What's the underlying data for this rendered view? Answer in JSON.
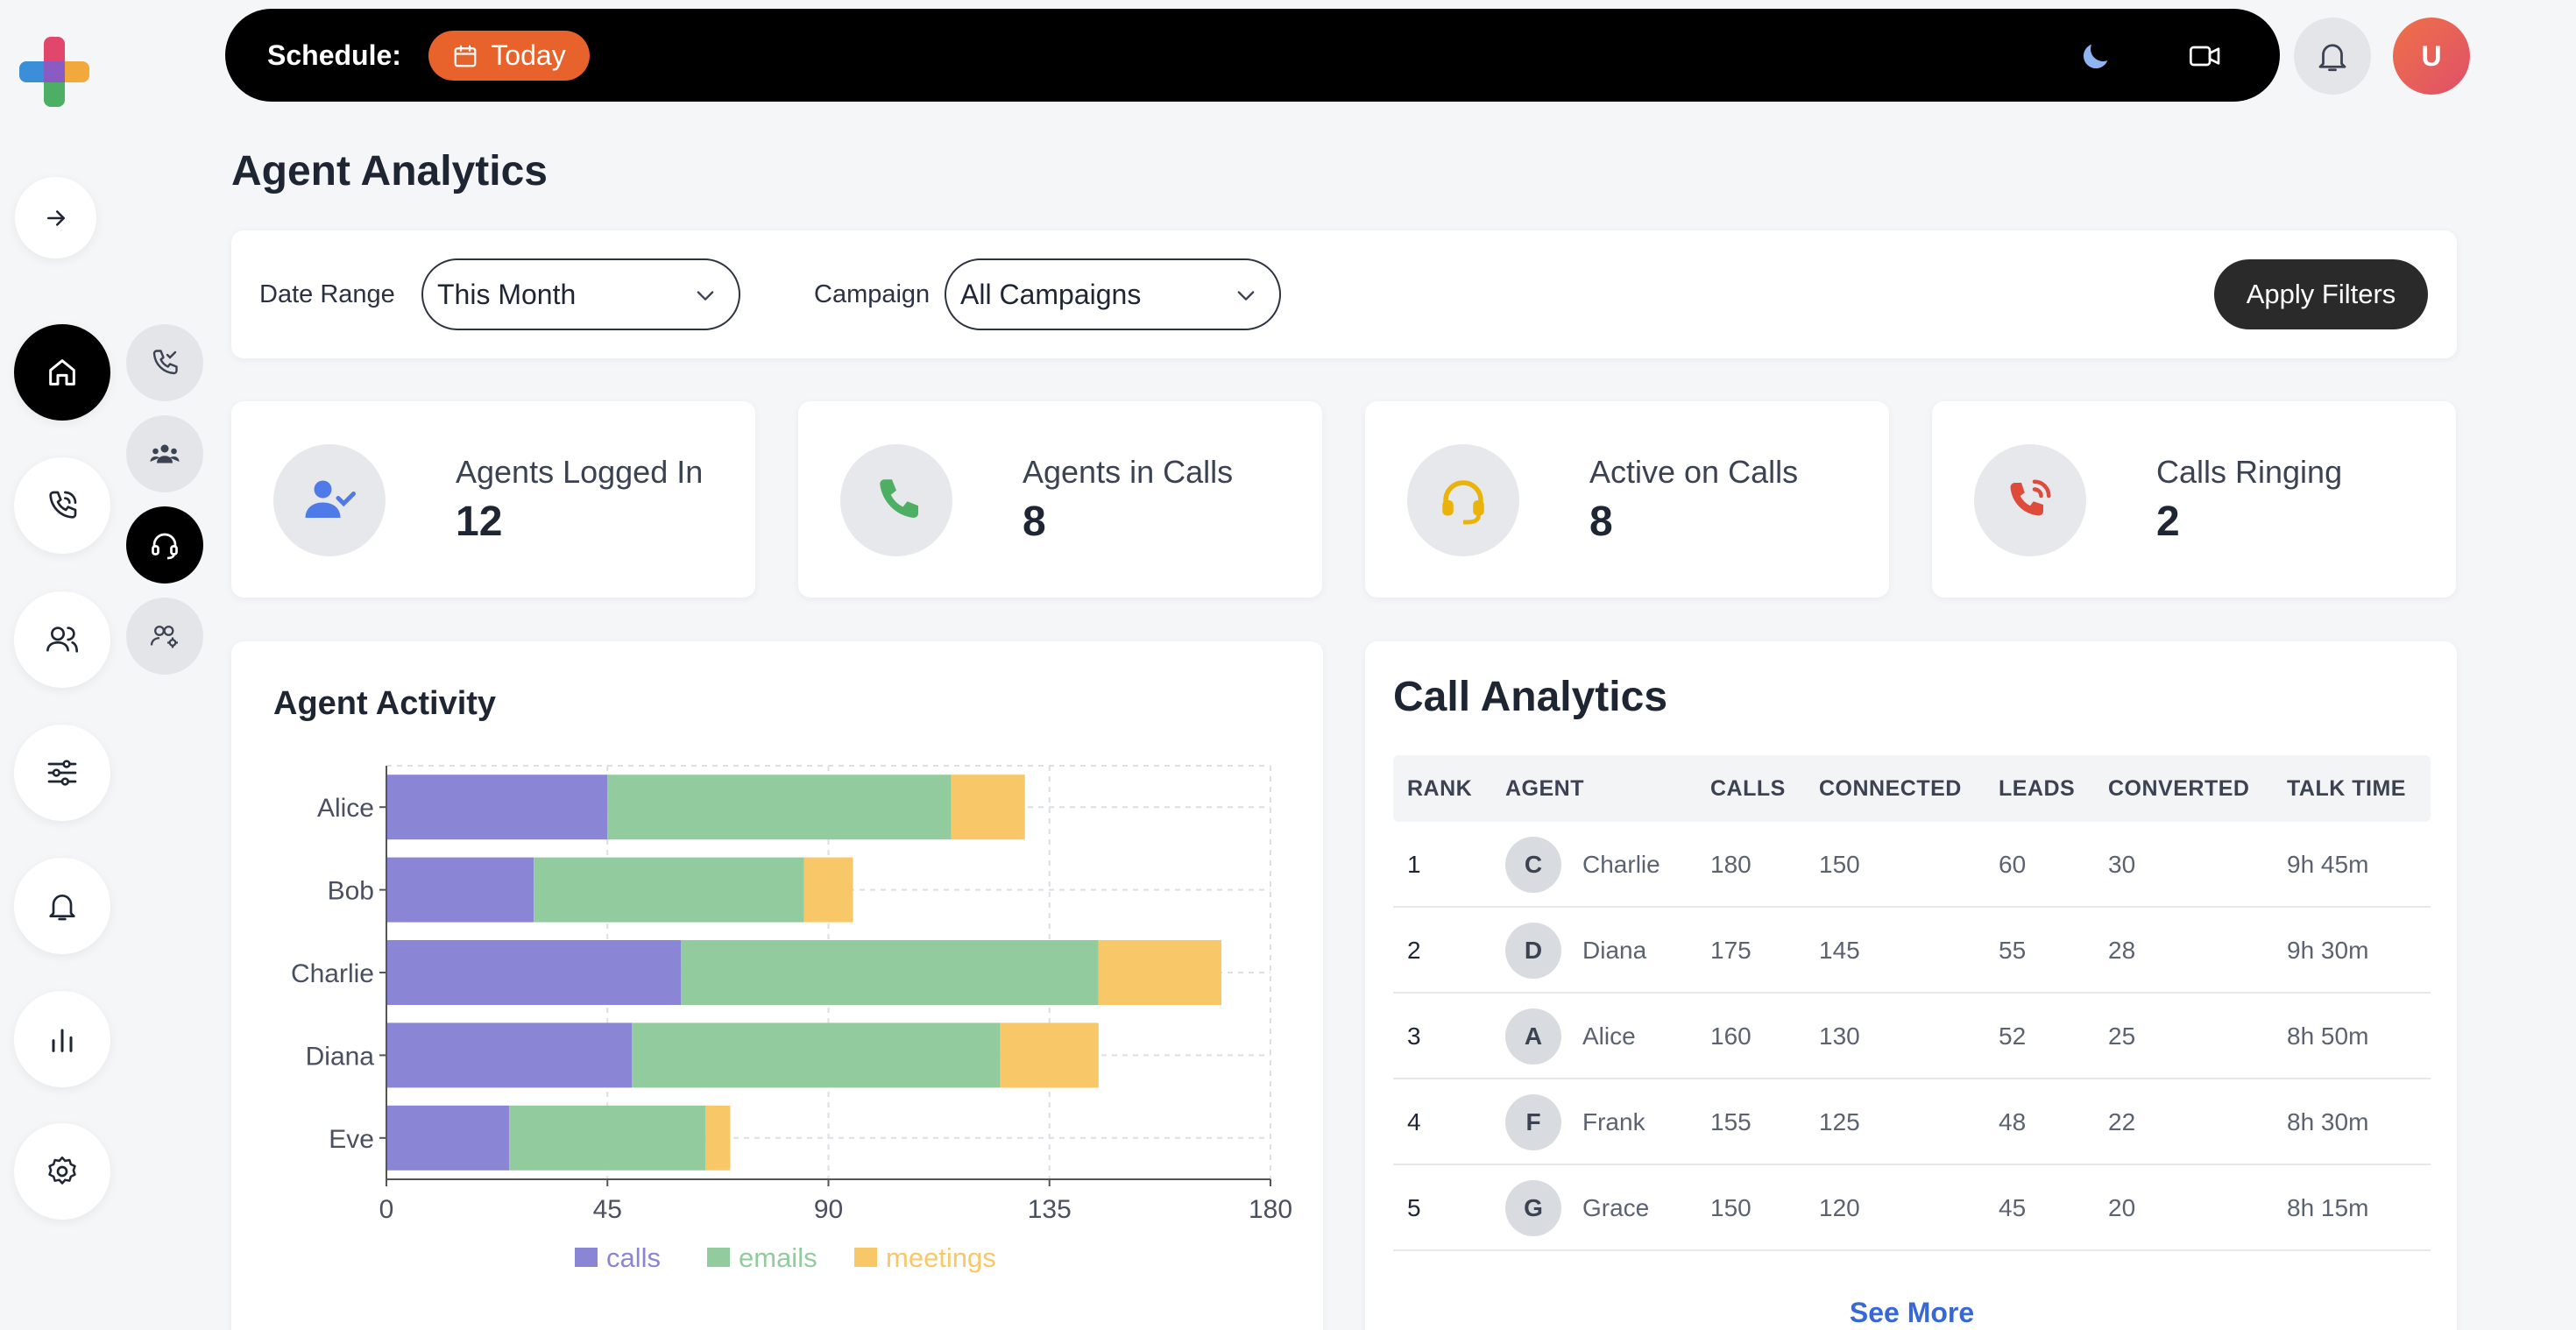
{
  "topbar": {
    "schedule_label": "Schedule:",
    "today_label": "Today",
    "avatar_initial": "U"
  },
  "page_title": "Agent Analytics",
  "filters": {
    "date_range_label": "Date Range",
    "date_range_value": "This Month",
    "campaign_label": "Campaign",
    "campaign_value": "All Campaigns",
    "apply_label": "Apply Filters"
  },
  "stats": [
    {
      "label": "Agents Logged In",
      "value": "12",
      "icon": "user-check-icon",
      "color": "#4f7be8"
    },
    {
      "label": "Agents in Calls",
      "value": "8",
      "icon": "phone-icon",
      "color": "#4caf64"
    },
    {
      "label": "Active on Calls",
      "value": "8",
      "icon": "headset-icon",
      "color": "#eab308"
    },
    {
      "label": "Calls Ringing",
      "value": "2",
      "icon": "phone-ringing-icon",
      "color": "#e04a3a"
    }
  ],
  "agent_activity": {
    "title": "Agent Activity",
    "chart_data": {
      "type": "bar",
      "orientation": "horizontal",
      "stacked": true,
      "categories": [
        "Alice",
        "Bob",
        "Charlie",
        "Diana",
        "Eve"
      ],
      "series": [
        {
          "name": "calls",
          "values": [
            45,
            30,
            60,
            50,
            25
          ],
          "color": "#8b85d6"
        },
        {
          "name": "emails",
          "values": [
            70,
            55,
            85,
            75,
            40
          ],
          "color": "#92cc9e"
        },
        {
          "name": "meetings",
          "values": [
            15,
            10,
            25,
            20,
            5
          ],
          "color": "#f8c767"
        }
      ],
      "xlim": [
        0,
        180
      ],
      "xticks": [
        0,
        45,
        90,
        135,
        180
      ],
      "grid": true,
      "legend": "bottom"
    }
  },
  "call_analytics": {
    "title": "Call Analytics",
    "columns": [
      "RANK",
      "AGENT",
      "CALLS",
      "CONNECTED",
      "LEADS",
      "CONVERTED",
      "TALK TIME"
    ],
    "rows": [
      {
        "rank": "1",
        "initial": "C",
        "agent": "Charlie",
        "calls": "180",
        "connected": "150",
        "leads": "60",
        "converted": "30",
        "talk_time": "9h 45m"
      },
      {
        "rank": "2",
        "initial": "D",
        "agent": "Diana",
        "calls": "175",
        "connected": "145",
        "leads": "55",
        "converted": "28",
        "talk_time": "9h 30m"
      },
      {
        "rank": "3",
        "initial": "A",
        "agent": "Alice",
        "calls": "160",
        "connected": "130",
        "leads": "52",
        "converted": "25",
        "talk_time": "8h 50m"
      },
      {
        "rank": "4",
        "initial": "F",
        "agent": "Frank",
        "calls": "155",
        "connected": "125",
        "leads": "48",
        "converted": "22",
        "talk_time": "8h 30m"
      },
      {
        "rank": "5",
        "initial": "G",
        "agent": "Grace",
        "calls": "150",
        "connected": "120",
        "leads": "45",
        "converted": "20",
        "talk_time": "8h 15m"
      }
    ],
    "see_more_label": "See More"
  }
}
